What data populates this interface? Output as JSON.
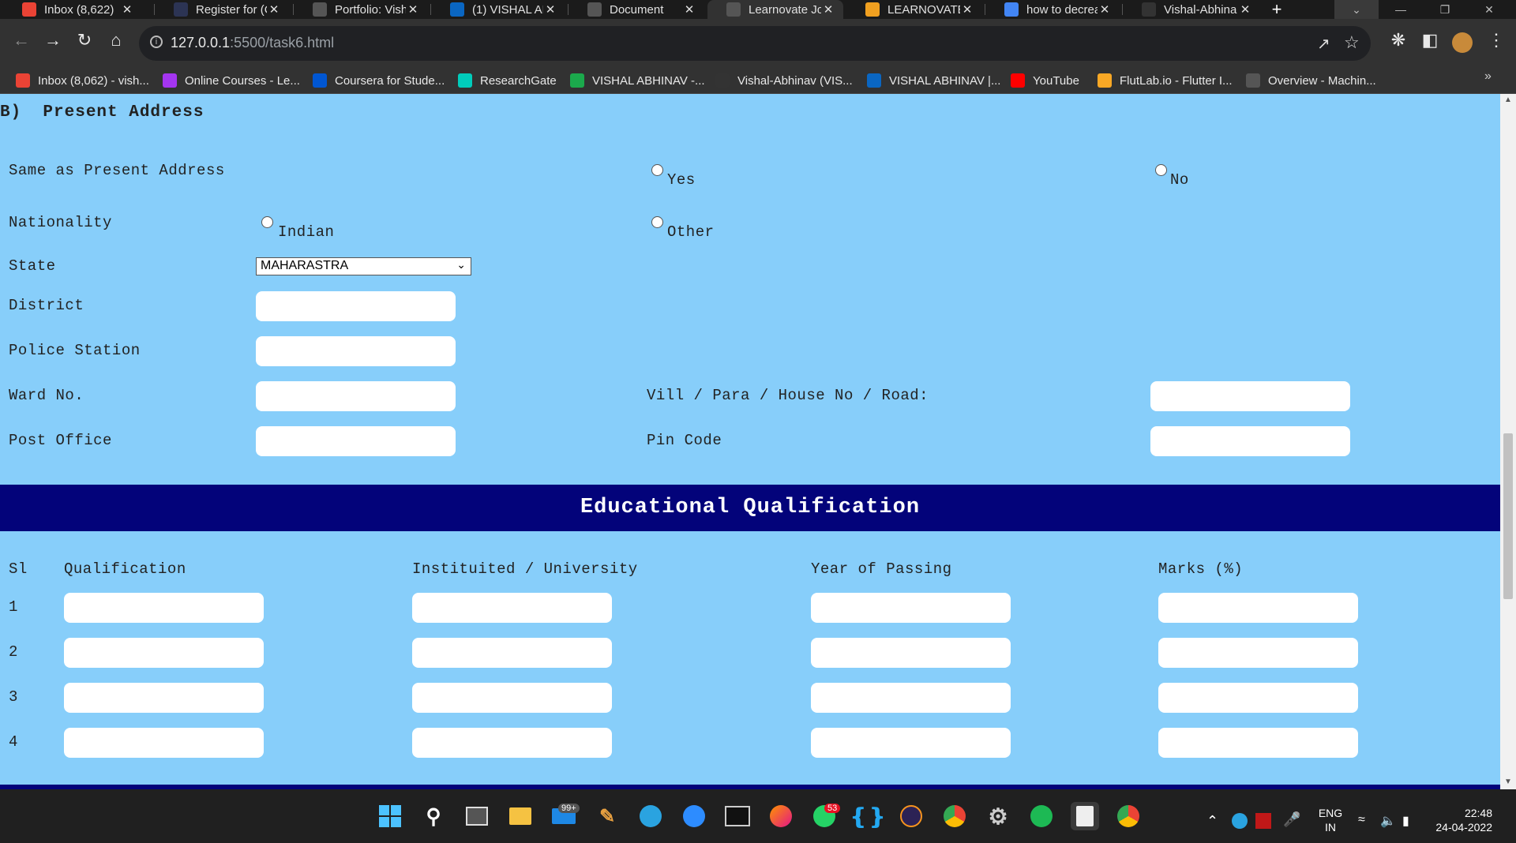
{
  "browser": {
    "tabs": [
      {
        "title": "Inbox (8,622)",
        "icon": "gmail-icon",
        "color": "#ea4335"
      },
      {
        "title": "Register for (C",
        "icon": "hackerearth-icon",
        "color": "#2c3454"
      },
      {
        "title": "Portfolio: Vish",
        "icon": "globe-icon",
        "color": "#555"
      },
      {
        "title": "(1) VISHAL AB",
        "icon": "linkedin-icon",
        "color": "#0a66c2"
      },
      {
        "title": "Document",
        "icon": "globe-icon",
        "color": "#555"
      },
      {
        "title": "Learnovate Jol",
        "icon": "globe-icon",
        "color": "#555"
      },
      {
        "title": "LEARNOVATE",
        "icon": "learnovate-icon",
        "color": "#f0a020"
      },
      {
        "title": "how to decrea",
        "icon": "google-icon",
        "color": "#4285f4"
      },
      {
        "title": "Vishal-Abhina",
        "icon": "github-icon",
        "color": "#333"
      }
    ],
    "active_tab": 5,
    "new_tab_label": "+",
    "url_host": "127.0.0.1",
    "url_rest": ":5500/task6.html",
    "bookmarks": [
      {
        "label": "Inbox (8,062) - vish...",
        "icon": "gmail-icon",
        "color": "#ea4335"
      },
      {
        "label": "Online Courses - Le...",
        "icon": "udemy-icon",
        "color": "#a435f0"
      },
      {
        "label": "Coursera for Stude...",
        "icon": "coursera-icon",
        "color": "#0056d2"
      },
      {
        "label": "ResearchGate",
        "icon": "researchgate-icon",
        "color": "#00ccbb"
      },
      {
        "label": "VISHAL ABHINAV -...",
        "icon": "hackerrank-icon",
        "color": "#1ba94c"
      },
      {
        "label": "Vishal-Abhinav (VIS...",
        "icon": "github-icon",
        "color": "#333"
      },
      {
        "label": "VISHAL ABHINAV |...",
        "icon": "linkedin-icon",
        "color": "#0a66c2"
      },
      {
        "label": "YouTube",
        "icon": "youtube-icon",
        "color": "#ff0000"
      },
      {
        "label": "FlutLab.io - Flutter I...",
        "icon": "flutlab-icon",
        "color": "#f9a825"
      },
      {
        "label": "Overview - Machin...",
        "icon": "overview-icon",
        "color": "#555"
      }
    ]
  },
  "form": {
    "section_heading": "B)  Present Address",
    "same_as_label": "Same as Present Address",
    "yes_label": "Yes",
    "no_label": "No",
    "nationality_label": "Nationality",
    "indian_label": "Indian",
    "other_label": "Other",
    "state_label": "State",
    "state_value": "MAHARASTRA",
    "district_label": "District",
    "police_label": "Police Station",
    "ward_label": "Ward No.",
    "vill_label": "Vill / Para / House No / Road:",
    "post_label": "Post Office",
    "pin_label": "Pin Code"
  },
  "education": {
    "heading": "Educational Qualification",
    "columns": [
      "Sl",
      "Qualification",
      "Instituited / University",
      "Year of Passing",
      "Marks (%)"
    ],
    "rows": [
      "1",
      "2",
      "3",
      "4"
    ]
  },
  "taskbar": {
    "mail_badge": "99+",
    "whatsapp_badge": "53",
    "lang_top": "ENG",
    "lang_bottom": "IN",
    "time": "22:48",
    "date": "24-04-2022"
  }
}
